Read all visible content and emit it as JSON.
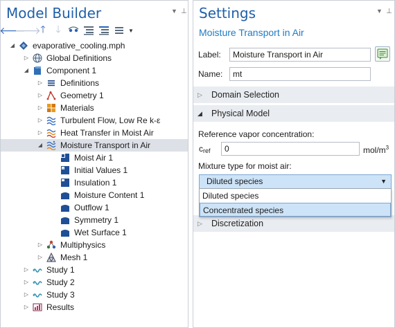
{
  "model_builder": {
    "title": "Model Builder",
    "toolbar": [
      "back-arrow-icon",
      "forward-arrow-icon",
      "move-up-icon",
      "move-down-icon",
      "show-icon",
      "collapse-all-icon",
      "expand-all-icon",
      "view-options-icon"
    ],
    "tree": [
      {
        "label": "evaporative_cooling.mph",
        "icon": "mph-file-icon",
        "caret": "down",
        "level": 0
      },
      {
        "label": "Global Definitions",
        "icon": "globe-icon",
        "caret": "right",
        "level": 1
      },
      {
        "label": "Component 1",
        "icon": "component-icon",
        "caret": "down",
        "level": 1
      },
      {
        "label": "Definitions",
        "icon": "definitions-icon",
        "caret": "right",
        "level": 2
      },
      {
        "label": "Geometry 1",
        "icon": "geometry-icon",
        "caret": "right",
        "level": 2
      },
      {
        "label": "Materials",
        "icon": "materials-icon",
        "caret": "right",
        "level": 2
      },
      {
        "label": "Turbulent Flow, Low Re k-ε",
        "icon": "turbulent-flow-icon",
        "caret": "right",
        "level": 2
      },
      {
        "label": "Heat Transfer in Moist Air",
        "icon": "heat-transfer-icon",
        "caret": "right",
        "level": 2
      },
      {
        "label": "Moisture Transport in Air",
        "icon": "moisture-transport-icon",
        "caret": "down",
        "level": 2,
        "selected": true
      },
      {
        "label": "Moist Air 1",
        "icon": "moist-air-icon",
        "caret": "none",
        "level": 3
      },
      {
        "label": "Initial Values 1",
        "icon": "initial-values-icon",
        "caret": "none",
        "level": 3
      },
      {
        "label": "Insulation 1",
        "icon": "insulation-icon",
        "caret": "none",
        "level": 3
      },
      {
        "label": "Moisture Content 1",
        "icon": "moisture-content-icon",
        "caret": "none",
        "level": 3
      },
      {
        "label": "Outflow 1",
        "icon": "outflow-icon",
        "caret": "none",
        "level": 3
      },
      {
        "label": "Symmetry 1",
        "icon": "symmetry-icon",
        "caret": "none",
        "level": 3
      },
      {
        "label": "Wet Surface 1",
        "icon": "wet-surface-icon",
        "caret": "none",
        "level": 3
      },
      {
        "label": "Multiphysics",
        "icon": "multiphysics-icon",
        "caret": "right",
        "level": 2
      },
      {
        "label": "Mesh 1",
        "icon": "mesh-icon",
        "caret": "right",
        "level": 2
      },
      {
        "label": "Study 1",
        "icon": "study-icon",
        "caret": "right",
        "level": 1
      },
      {
        "label": "Study 2",
        "icon": "study-icon",
        "caret": "right",
        "level": 1
      },
      {
        "label": "Study 3",
        "icon": "study-icon",
        "caret": "right",
        "level": 1
      },
      {
        "label": "Results",
        "icon": "results-icon",
        "caret": "right",
        "level": 1
      }
    ]
  },
  "settings": {
    "title": "Settings",
    "subtitle": "Moisture Transport in Air",
    "label_field": {
      "label": "Label:",
      "value": "Moisture Transport in Air"
    },
    "name_field": {
      "label": "Name:",
      "value": "mt"
    },
    "sections": {
      "domain_selection": "Domain Selection",
      "physical_model": "Physical Model",
      "discretization": "Discretization"
    },
    "ref_vapor": {
      "label": "Reference vapor concentration:",
      "symbol": "c",
      "subscript": "ref",
      "value": "0",
      "unit": "mol/m",
      "unit_exp": "3"
    },
    "mixture": {
      "label": "Mixture type for moist air:",
      "selected": "Diluted species",
      "options": [
        "Diluted species",
        "Concentrated species"
      ],
      "highlighted": "Concentrated species"
    }
  },
  "colors": {
    "title_blue": "#1f5fa8",
    "subtitle_blue": "#1f7bc4",
    "selection_gray": "#dde1e7",
    "section_bg": "#e9ecf0",
    "dropdown_highlight": "#cde3f7"
  }
}
